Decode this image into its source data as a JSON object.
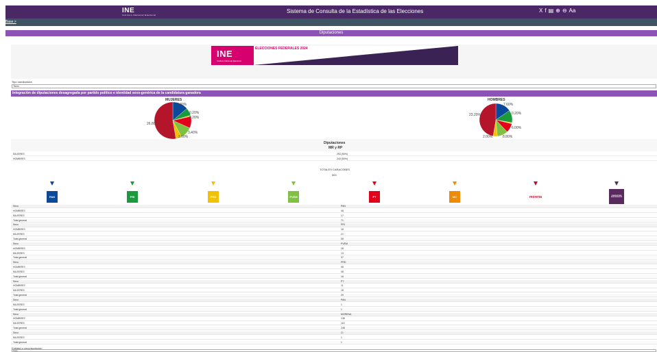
{
  "header": {
    "logo_text": "INE",
    "logo_sub": "Instituto Nacional Electoral",
    "title": "Sistema de Consulta de la Estadística de las Elecciones",
    "tools": [
      "X",
      "f",
      "▤",
      "⊕",
      "⊖",
      "Aa"
    ]
  },
  "subnav": {
    "link": "Base >"
  },
  "section": {
    "title": "Diputaciones"
  },
  "banner": {
    "logo": "INE",
    "logo_sub": "Instituto Nacional Electoral",
    "title": "ELECCIONES FEDERALES 2024"
  },
  "filter": {
    "label": "Tipo candidatura",
    "value": "Todo"
  },
  "integration": {
    "title": "Integración de diputaciones desagregada por partido político e identidad sexo-genérica de la candidatura ganadora"
  },
  "pies": [
    {
      "title": "MUJERES",
      "labels": [
        "3.40%",
        "0.20%",
        "0.20%",
        "3.40%",
        "26.80%",
        "1.40%",
        "2.60%"
      ]
    },
    {
      "title": "HOMBRES",
      "labels": [
        "7.60%",
        "0.20%",
        "23.20%",
        "6.00%",
        "2.00%",
        "8.80%"
      ]
    }
  ],
  "summary": {
    "title": "Diputaciones",
    "subtitle": "MR y RP",
    "rows": [
      {
        "label": "MUJERES",
        "value": "253 (50%)"
      },
      {
        "label": "HOMBRES",
        "value": "243 (50%)"
      }
    ],
    "total_label": "TOTALES CARACOBES",
    "total_value": "500"
  },
  "parties": [
    {
      "name": "PAN",
      "color": "#0b4a9b"
    },
    {
      "name": "PRI",
      "color": "#1a9a3c"
    },
    {
      "name": "PRD",
      "color": "#f2c200"
    },
    {
      "name": "PVEM",
      "color": "#7fc241"
    },
    {
      "name": "PT",
      "color": "#e3001b"
    },
    {
      "name": "MC",
      "color": "#f08a00"
    },
    {
      "name": "morena",
      "color": "#b5152b"
    },
    {
      "name": "CANDIDATURA INDEPENDIENTE",
      "color": "#5a2a5e"
    }
  ],
  "table": {
    "rows": [
      {
        "c1": "Sexo",
        "c2": "PAN",
        "type": "hdr"
      },
      {
        "c1": "HOMBRES",
        "c2": "46",
        "type": ""
      },
      {
        "c1": "MUJERES",
        "c2": "17",
        "type": ""
      },
      {
        "c1": "Total general",
        "c2": "71",
        "type": "hl"
      },
      {
        "c1": "Sexo",
        "c2": "PRI",
        "type": "hdr"
      },
      {
        "c1": "HOMBRES",
        "c2": "18",
        "type": ""
      },
      {
        "c1": "MUJERES",
        "c2": "21",
        "type": ""
      },
      {
        "c1": "Total general",
        "c2": "35",
        "type": "hl"
      },
      {
        "c1": "Sexo",
        "c2": "PVEM",
        "type": "hdr"
      },
      {
        "c1": "HOMBRES",
        "c2": "28",
        "type": ""
      },
      {
        "c1": "MUJERES",
        "c2": "13",
        "type": ""
      },
      {
        "c1": "Total general",
        "c2": "37",
        "type": "hl"
      },
      {
        "c1": "Sexo",
        "c2": "PRD",
        "type": "hdr"
      },
      {
        "c1": "HOMBRES",
        "c2": "08",
        "type": ""
      },
      {
        "c1": "MUJERES",
        "c2": "08",
        "type": ""
      },
      {
        "c1": "Total general",
        "c2": "16",
        "type": "hl"
      },
      {
        "c1": "Sexo",
        "c2": "PT",
        "type": "hdr"
      },
      {
        "c1": "HOMBRES",
        "c2": "11",
        "type": ""
      },
      {
        "c1": "MUJERES",
        "c2": "18",
        "type": ""
      },
      {
        "c1": "Total general",
        "c2": "29",
        "type": "hl"
      },
      {
        "c1": "Sexo",
        "c2": "PAN",
        "type": "hdr"
      },
      {
        "c1": "MUJERES",
        "c2": "1",
        "type": ""
      },
      {
        "c1": "Total general",
        "c2": "1",
        "type": "hl"
      },
      {
        "c1": "Sexo",
        "c2": "MORENA",
        "type": "hdr"
      },
      {
        "c1": "HOMBRES",
        "c2": "138",
        "type": ""
      },
      {
        "c1": "MUJERES",
        "c2": "116",
        "type": ""
      },
      {
        "c1": "Total general",
        "c2": "246",
        "type": "hl"
      },
      {
        "c1": "Sexo",
        "c2": "CI",
        "type": "hdr"
      },
      {
        "c1": "MUJERES",
        "c2": "1",
        "type": ""
      },
      {
        "c1": "Total general",
        "c2": "1",
        "type": "hl"
      }
    ]
  },
  "bottom": {
    "label": "Entidad o circunscripción",
    "value": "Todo"
  }
}
